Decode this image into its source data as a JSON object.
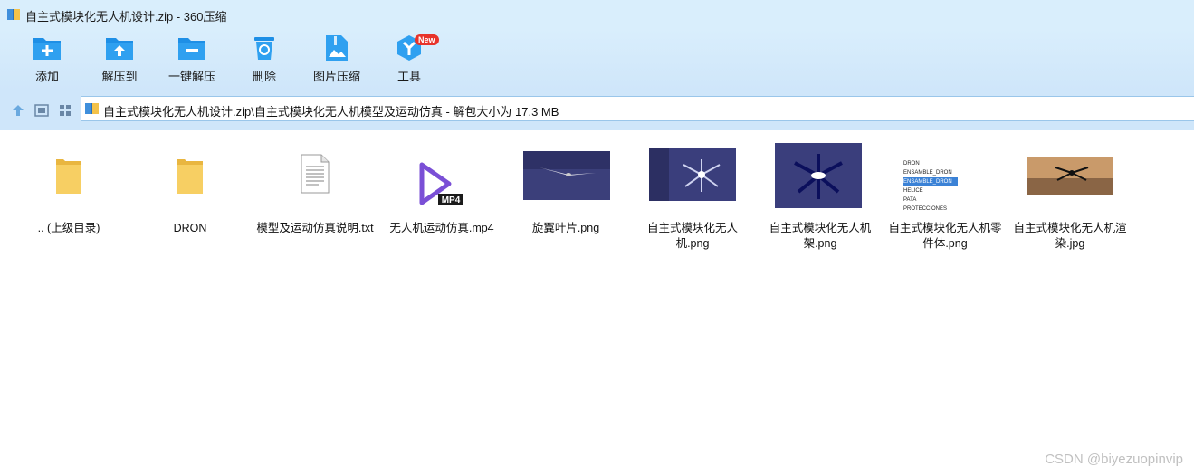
{
  "window": {
    "title": "自主式模块化无人机设计.zip - 360压缩"
  },
  "toolbar": {
    "add_label": "添加",
    "extract_label": "解压到",
    "oneclick_label": "一键解压",
    "delete_label": "删除",
    "image_compress_label": "图片压缩",
    "tools_label": "工具",
    "tools_badge": "New"
  },
  "address": {
    "path": "自主式模块化无人机设计.zip\\自主式模块化无人机模型及运动仿真 - 解包大小为 17.3 MB"
  },
  "files": [
    {
      "name": ".. (上级目录)",
      "icon": "folder-icon"
    },
    {
      "name": "DRON",
      "icon": "folder-icon"
    },
    {
      "name": "模型及运动仿真说明.txt",
      "icon": "text-file-icon"
    },
    {
      "name": "无人机运动仿真.mp4",
      "icon": "video-file-icon",
      "tag": "MP4"
    },
    {
      "name": "旋翼叶片.png",
      "icon": "image-thumbnail"
    },
    {
      "name": "自主式模块化无人机.png",
      "icon": "image-thumbnail"
    },
    {
      "name": "自主式模块化无人机架.png",
      "icon": "image-thumbnail"
    },
    {
      "name": "自主式模块化无人机零件体.png",
      "icon": "image-thumbnail",
      "tree": [
        "DRON",
        "ENSAMBLE_DRON",
        "ENSAMBLE_DRON",
        "HELICE",
        "PATA",
        "PROTECCIONES"
      ]
    },
    {
      "name": "自主式模块化无人机渲染.jpg",
      "icon": "image-thumbnail"
    }
  ],
  "watermark": "CSDN @biyezuopinvip",
  "colors": {
    "accent": "#1e8fe6",
    "toolbar_bg": "#d9eefc",
    "folder": "#f5c85a",
    "badge": "#e8332a"
  }
}
